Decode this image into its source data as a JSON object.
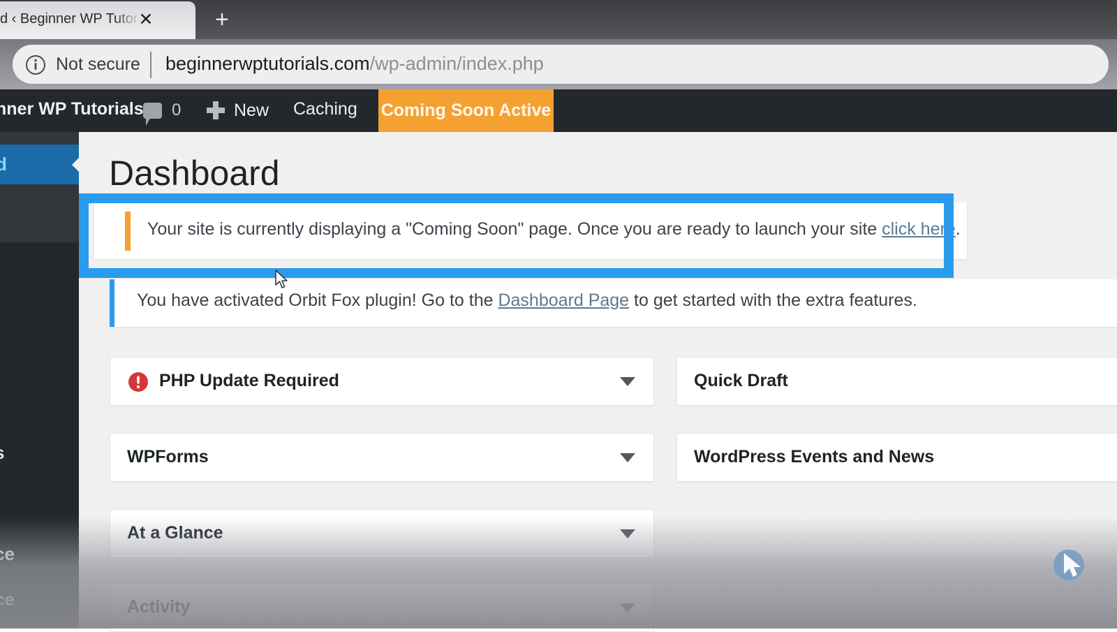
{
  "browser": {
    "tab_title": "d ‹ Beginner WP Tutoria",
    "tab_close_label": "✕",
    "new_tab_label": "+",
    "security_label": "Not secure",
    "url_host": "beginnerwptutorials.com",
    "url_path": "/wp-admin/index.php",
    "info_icon": "info-circle-icon"
  },
  "adminbar": {
    "site_name": "nner WP Tutorials",
    "comment_icon": "comment-bubble-icon",
    "comment_count": "0",
    "new_icon": "plus-icon",
    "new_label": "New",
    "caching_label": "Caching",
    "coming_soon_label": "Coming Soon Active",
    "coming_soon_color": "#f5a132"
  },
  "sidebar": {
    "active_label": "d",
    "active_color": "#1b6ca8",
    "fragments": [
      "s",
      "ce",
      "ce"
    ]
  },
  "main": {
    "page_title": "Dashboard",
    "notices": [
      {
        "text_before": "Your site is currently displaying a \"Coming Soon\" page. Once you are ready to launch your site ",
        "link_text": "click here",
        "text_after": ".",
        "accent_color": "#f5a132"
      },
      {
        "text_before": "You have activated Orbit Fox plugin! Go to the ",
        "link_text": "Dashboard Page",
        "text_after": " to get started with the extra features.",
        "accent_color": "#2a9bed"
      }
    ],
    "highlight_color": "#2a9bed",
    "widgets_left": [
      {
        "title": "PHP Update Required",
        "icon": "error-circle-icon",
        "toggle": "chevron-down-icon"
      },
      {
        "title": "WPForms",
        "icon": "",
        "toggle": "chevron-down-icon"
      },
      {
        "title": "At a Glance",
        "icon": "",
        "toggle": "chevron-down-icon"
      }
    ],
    "widget_activity": {
      "title": "Activity",
      "toggle": "chevron-down-icon"
    },
    "widgets_right": [
      {
        "title": "Quick Draft"
      },
      {
        "title": "WordPress Events and News"
      }
    ]
  }
}
